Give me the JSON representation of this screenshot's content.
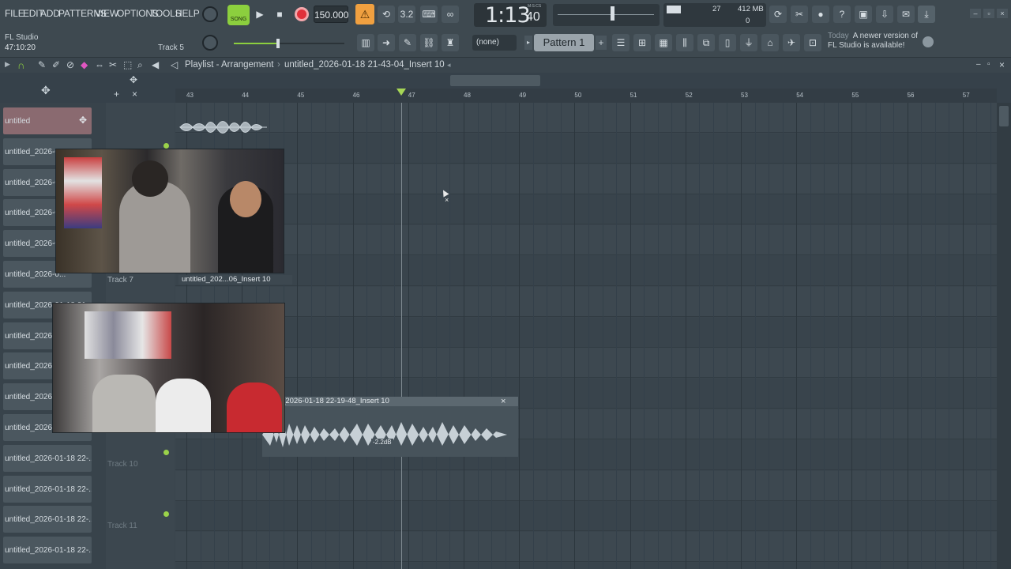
{
  "menu": [
    "FILE",
    "EDIT",
    "ADD",
    "PATTERNS",
    "VIEW",
    "OPTIONS",
    "TOOLS",
    "HELP"
  ],
  "transport": {
    "song_label": "SONG",
    "tempo": "150.000",
    "time": "1:13",
    "time_small": "40",
    "msc_label": "M:S:CS"
  },
  "status": {
    "app_name": "FL Studio",
    "elapsed": "47:10:20",
    "track_label": "Track 5"
  },
  "monitor": {
    "cpu": "27",
    "ram": "412 MB",
    "voices": "0"
  },
  "toolbar": {
    "none_label": "(none)",
    "pattern_label": "Pattern 1"
  },
  "hint": {
    "date": "Today",
    "text": "A newer version of FL Studio is available!"
  },
  "playlist": {
    "title": "Playlist - Arrangement",
    "arrangement": "untitled_2026-01-18 21-43-04_Insert 10",
    "ruler_ticks": [
      "43",
      "44",
      "45",
      "46",
      "47",
      "48",
      "49",
      "50",
      "51",
      "52",
      "53",
      "54",
      "55",
      "56",
      "57"
    ]
  },
  "tracks": [
    {
      "label": "untitled"
    },
    {
      "label": "untitled_2026-01-18 21..."
    },
    {
      "label": "untitled_2026-0..."
    },
    {
      "label": "untitled_2026-0..."
    },
    {
      "label": "untitled_2026-0..."
    },
    {
      "label": "untitled_2026-0..."
    },
    {
      "label": "untitled_2026-01-18 21..."
    },
    {
      "label": "untitled_2026-0..."
    },
    {
      "label": "untitled_2026-0..."
    },
    {
      "label": "untitled_2026-0..."
    },
    {
      "label": "untitled_2026-0..."
    },
    {
      "label": "untitled_2026-01-18 22-..."
    },
    {
      "label": "untitled_2026-01-18 22-..."
    },
    {
      "label": "untitled_2026-01-18 22-..."
    },
    {
      "label": "untitled_2026-01-18 22-..."
    }
  ],
  "track_names": {
    "t7": "Track 7",
    "t10": "Track 10",
    "t11": "Track 11"
  },
  "clips": {
    "clip_a": "untitled_202...06_Insert 10",
    "clip_b": "titled_2026-01-18 22-19-48_Insert 10",
    "clip_b_gain": "-2.2dB"
  },
  "colors": {
    "accent_green": "#9bd34a",
    "record": "#e0303a",
    "orange": "#f0a040"
  }
}
